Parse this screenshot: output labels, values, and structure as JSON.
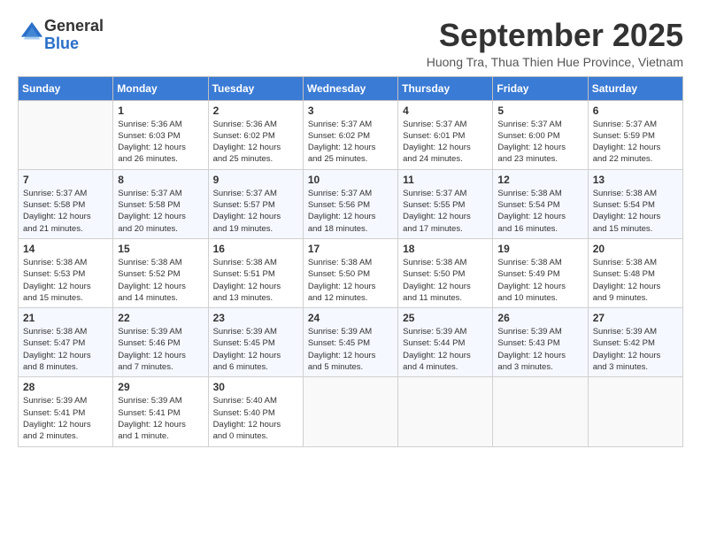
{
  "logo": {
    "general": "General",
    "blue": "Blue"
  },
  "title": "September 2025",
  "location": "Huong Tra, Thua Thien Hue Province, Vietnam",
  "weekdays": [
    "Sunday",
    "Monday",
    "Tuesday",
    "Wednesday",
    "Thursday",
    "Friday",
    "Saturday"
  ],
  "weeks": [
    [
      {
        "num": "",
        "info": ""
      },
      {
        "num": "1",
        "info": "Sunrise: 5:36 AM\nSunset: 6:03 PM\nDaylight: 12 hours\nand 26 minutes."
      },
      {
        "num": "2",
        "info": "Sunrise: 5:36 AM\nSunset: 6:02 PM\nDaylight: 12 hours\nand 25 minutes."
      },
      {
        "num": "3",
        "info": "Sunrise: 5:37 AM\nSunset: 6:02 PM\nDaylight: 12 hours\nand 25 minutes."
      },
      {
        "num": "4",
        "info": "Sunrise: 5:37 AM\nSunset: 6:01 PM\nDaylight: 12 hours\nand 24 minutes."
      },
      {
        "num": "5",
        "info": "Sunrise: 5:37 AM\nSunset: 6:00 PM\nDaylight: 12 hours\nand 23 minutes."
      },
      {
        "num": "6",
        "info": "Sunrise: 5:37 AM\nSunset: 5:59 PM\nDaylight: 12 hours\nand 22 minutes."
      }
    ],
    [
      {
        "num": "7",
        "info": "Sunrise: 5:37 AM\nSunset: 5:58 PM\nDaylight: 12 hours\nand 21 minutes."
      },
      {
        "num": "8",
        "info": "Sunrise: 5:37 AM\nSunset: 5:58 PM\nDaylight: 12 hours\nand 20 minutes."
      },
      {
        "num": "9",
        "info": "Sunrise: 5:37 AM\nSunset: 5:57 PM\nDaylight: 12 hours\nand 19 minutes."
      },
      {
        "num": "10",
        "info": "Sunrise: 5:37 AM\nSunset: 5:56 PM\nDaylight: 12 hours\nand 18 minutes."
      },
      {
        "num": "11",
        "info": "Sunrise: 5:37 AM\nSunset: 5:55 PM\nDaylight: 12 hours\nand 17 minutes."
      },
      {
        "num": "12",
        "info": "Sunrise: 5:38 AM\nSunset: 5:54 PM\nDaylight: 12 hours\nand 16 minutes."
      },
      {
        "num": "13",
        "info": "Sunrise: 5:38 AM\nSunset: 5:54 PM\nDaylight: 12 hours\nand 15 minutes."
      }
    ],
    [
      {
        "num": "14",
        "info": "Sunrise: 5:38 AM\nSunset: 5:53 PM\nDaylight: 12 hours\nand 15 minutes."
      },
      {
        "num": "15",
        "info": "Sunrise: 5:38 AM\nSunset: 5:52 PM\nDaylight: 12 hours\nand 14 minutes."
      },
      {
        "num": "16",
        "info": "Sunrise: 5:38 AM\nSunset: 5:51 PM\nDaylight: 12 hours\nand 13 minutes."
      },
      {
        "num": "17",
        "info": "Sunrise: 5:38 AM\nSunset: 5:50 PM\nDaylight: 12 hours\nand 12 minutes."
      },
      {
        "num": "18",
        "info": "Sunrise: 5:38 AM\nSunset: 5:50 PM\nDaylight: 12 hours\nand 11 minutes."
      },
      {
        "num": "19",
        "info": "Sunrise: 5:38 AM\nSunset: 5:49 PM\nDaylight: 12 hours\nand 10 minutes."
      },
      {
        "num": "20",
        "info": "Sunrise: 5:38 AM\nSunset: 5:48 PM\nDaylight: 12 hours\nand 9 minutes."
      }
    ],
    [
      {
        "num": "21",
        "info": "Sunrise: 5:38 AM\nSunset: 5:47 PM\nDaylight: 12 hours\nand 8 minutes."
      },
      {
        "num": "22",
        "info": "Sunrise: 5:39 AM\nSunset: 5:46 PM\nDaylight: 12 hours\nand 7 minutes."
      },
      {
        "num": "23",
        "info": "Sunrise: 5:39 AM\nSunset: 5:45 PM\nDaylight: 12 hours\nand 6 minutes."
      },
      {
        "num": "24",
        "info": "Sunrise: 5:39 AM\nSunset: 5:45 PM\nDaylight: 12 hours\nand 5 minutes."
      },
      {
        "num": "25",
        "info": "Sunrise: 5:39 AM\nSunset: 5:44 PM\nDaylight: 12 hours\nand 4 minutes."
      },
      {
        "num": "26",
        "info": "Sunrise: 5:39 AM\nSunset: 5:43 PM\nDaylight: 12 hours\nand 3 minutes."
      },
      {
        "num": "27",
        "info": "Sunrise: 5:39 AM\nSunset: 5:42 PM\nDaylight: 12 hours\nand 3 minutes."
      }
    ],
    [
      {
        "num": "28",
        "info": "Sunrise: 5:39 AM\nSunset: 5:41 PM\nDaylight: 12 hours\nand 2 minutes."
      },
      {
        "num": "29",
        "info": "Sunrise: 5:39 AM\nSunset: 5:41 PM\nDaylight: 12 hours\nand 1 minute."
      },
      {
        "num": "30",
        "info": "Sunrise: 5:40 AM\nSunset: 5:40 PM\nDaylight: 12 hours\nand 0 minutes."
      },
      {
        "num": "",
        "info": ""
      },
      {
        "num": "",
        "info": ""
      },
      {
        "num": "",
        "info": ""
      },
      {
        "num": "",
        "info": ""
      }
    ]
  ]
}
